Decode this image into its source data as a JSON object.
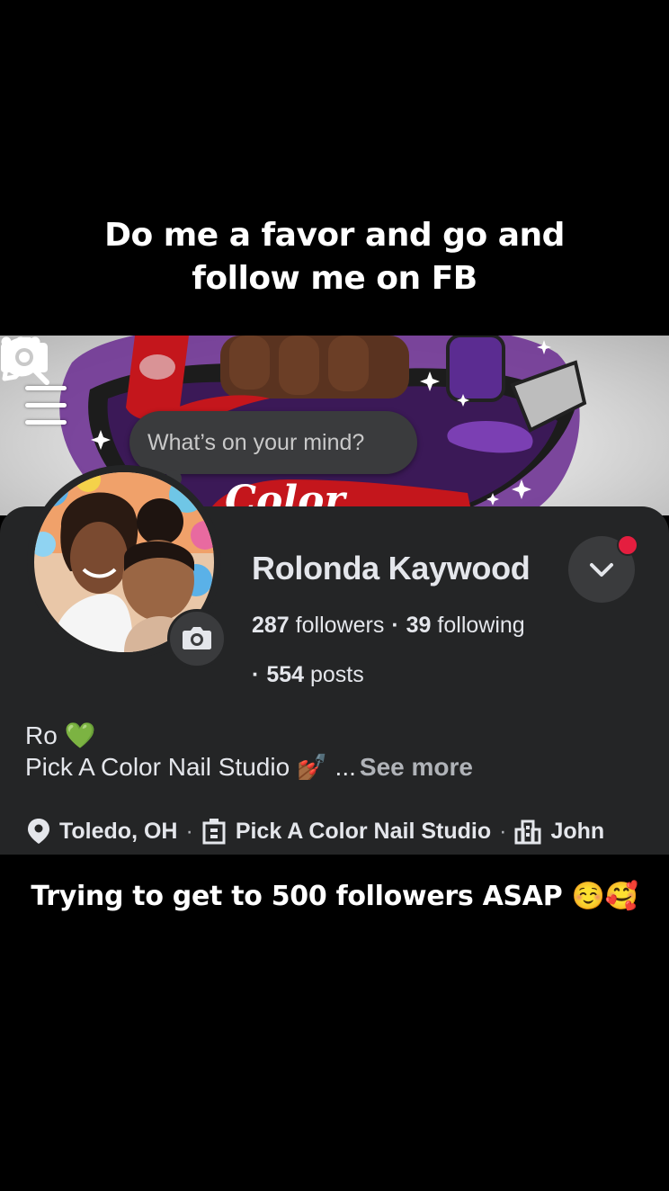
{
  "caption_top": [
    "Do me a favor and go and",
    "follow me on FB"
  ],
  "caption_bottom": "Trying to get to 500 followers ASAP ☺️🥰",
  "composer": {
    "placeholder": "What’s on your mind?"
  },
  "profile": {
    "name": "Rolonda Kaywood",
    "followers_count": "287",
    "followers_label": "followers",
    "following_count": "39",
    "following_label": "following",
    "posts_count": "554",
    "posts_label": "posts",
    "separator": "·"
  },
  "bio": {
    "line1": "Ro 💚",
    "line2": "Pick A Color Nail Studio 💅🏾 ...",
    "see_more": "See more"
  },
  "details": {
    "location": "Toledo, OH",
    "workplace": "Pick A Color Nail Studio",
    "other": "John",
    "separator": "·"
  },
  "icons": {
    "menu": "hamburger-icon",
    "edit": "pencil-icon",
    "more": "more-icon",
    "search": "search-icon",
    "cover_camera": "camera-icon",
    "avatar_camera": "camera-icon",
    "dropdown": "chevron-down-icon",
    "location": "location-pin-icon",
    "workplace": "building-icon",
    "other": "city-icon"
  },
  "colors": {
    "panel": "#242526",
    "button": "#3a3b3d",
    "notification": "#e41e3f",
    "text_primary": "#e4e6eb",
    "text_secondary": "#b0b3b8"
  }
}
